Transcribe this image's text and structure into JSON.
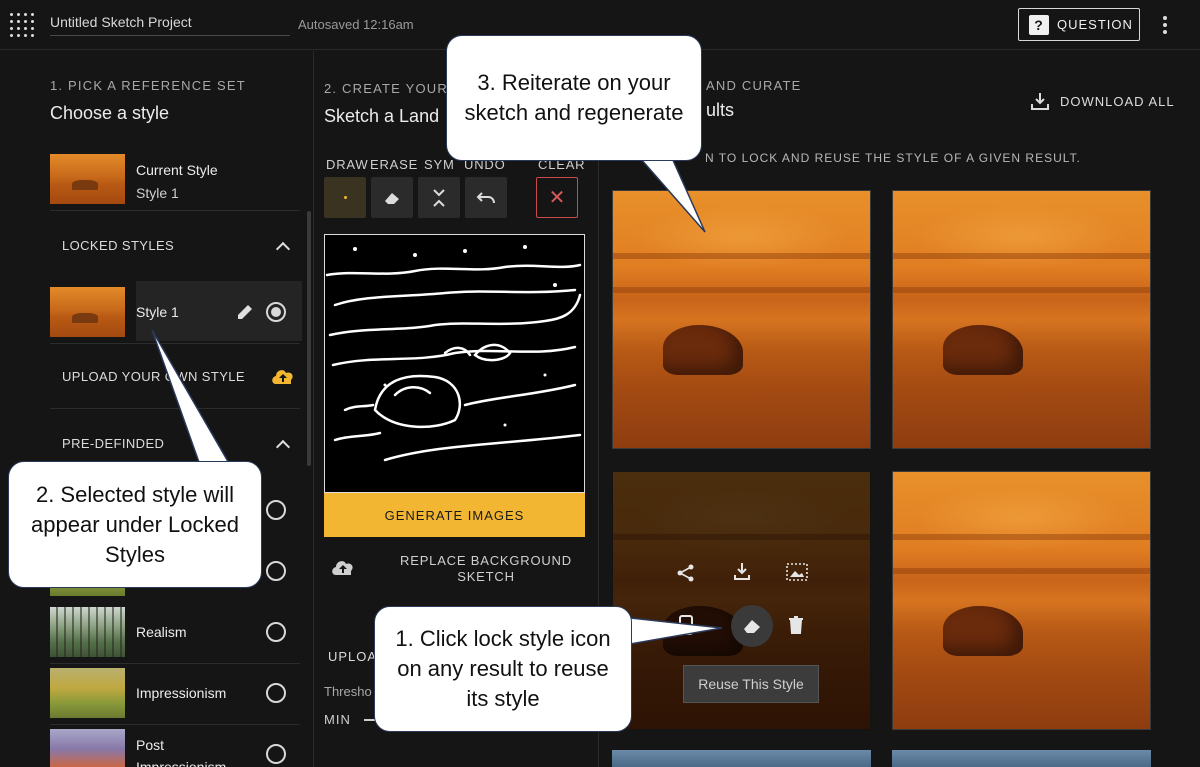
{
  "topbar": {
    "project_title": "Untitled Sketch Project",
    "autosaved": "Autosaved 12:16am",
    "question_label": "QUESTION"
  },
  "left_panel": {
    "step_label": "1. PICK A REFERENCE SET",
    "title": "Choose a style",
    "current_style": {
      "label": "Current Style",
      "name": "Style 1"
    },
    "locked_header": "LOCKED STYLES",
    "locked_items": [
      {
        "name": "Style 1",
        "selected": true
      }
    ],
    "upload_label": "UPLOAD YOUR OWN STYLE",
    "predefined_header": "PRE-DEFINDED",
    "predefined_items": [
      {
        "name": "",
        "selected": false
      },
      {
        "name": "",
        "selected": false
      },
      {
        "name": "Realism",
        "selected": false
      },
      {
        "name": "Impressionism",
        "selected": false
      },
      {
        "name": "Post Impressionism",
        "selected": false
      }
    ]
  },
  "middle_panel": {
    "step_label": "2. CREATE YOUR",
    "title": "Sketch a Land",
    "tools": {
      "draw": "DRAW",
      "erase": "ERASE",
      "sym": "SYM",
      "undo": "UNDO",
      "clear": "CLEAR"
    },
    "generate_label": "GENERATE IMAGES",
    "replace_label": "REPLACE BACKGROUND SKETCH",
    "upload_label": "UPLOA",
    "threshold_label": "Thresho",
    "min_label": "MIN"
  },
  "right_panel": {
    "step_label": "AND CURATE",
    "title": "ults",
    "download_all": "DOWNLOAD ALL",
    "hint": "N  TO LOCK AND REUSE THE STYLE OF A GIVEN RESULT.",
    "tooltip": "Reuse This Style"
  },
  "callouts": {
    "c1": "1. Click lock style icon on any result to reuse its style",
    "c2": "2. Selected style will appear under Locked Styles",
    "c3": "3. Reiterate on your sketch and regenerate"
  },
  "colors": {
    "accent": "#f2b632",
    "clear": "#c84a4a",
    "upload_icon": "#f2b632"
  }
}
